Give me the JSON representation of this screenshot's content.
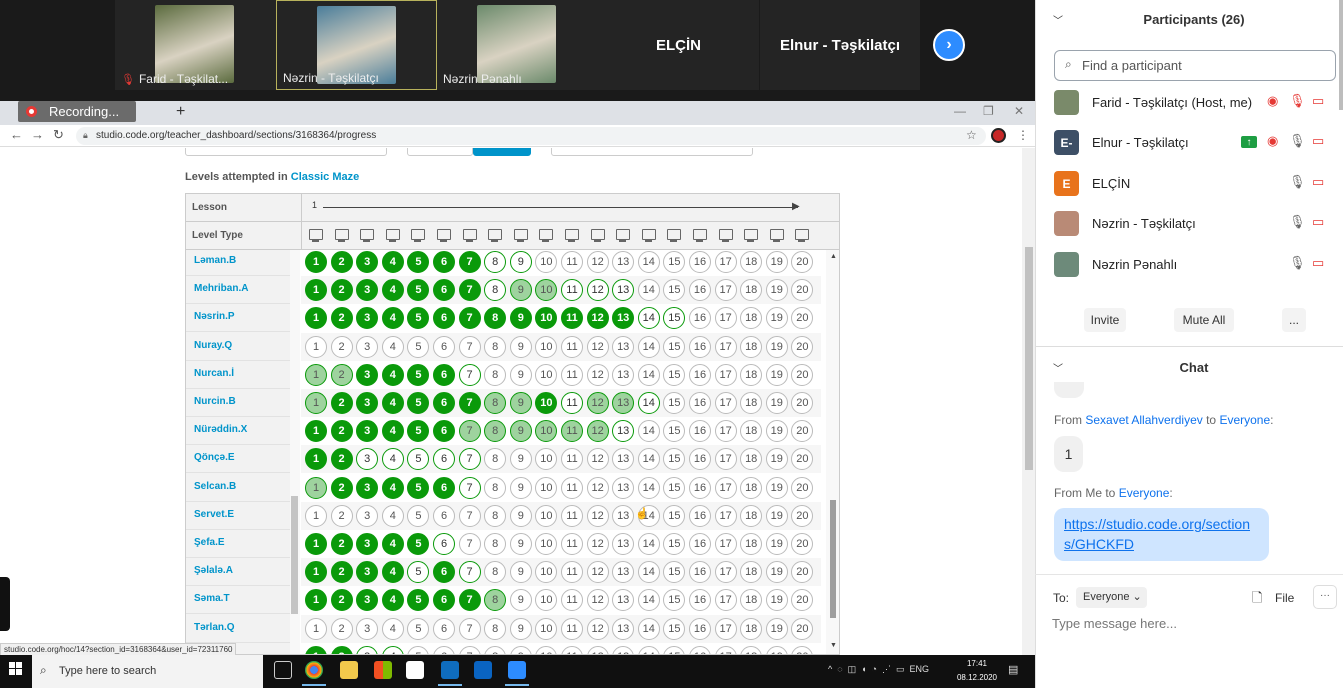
{
  "video_strip": {
    "tiles": [
      {
        "name": "Farid - Təşkilat...",
        "muted": true
      },
      {
        "name": "Nəzrin - Təşkilatçı",
        "muted": false
      },
      {
        "name": "Nəzrin Pənahlı",
        "muted": false
      },
      {
        "name": "ELÇİN",
        "muted": false
      },
      {
        "name": "Elnur - Təşkilatçı",
        "muted": false
      }
    ],
    "next_arrow": "›"
  },
  "recording": {
    "label": "Recording..."
  },
  "browser": {
    "url": "studio.code.org/teacher_dashboard/sections/3168364/progress",
    "status_url": "studio.code.org/hoc/14?section_id=3168364&user_id=72311760"
  },
  "page": {
    "heading_prefix": "Levels attempted in",
    "heading_link": "Classic Maze",
    "lesson_label": "Lesson",
    "lesson_number": "1",
    "level_type_label": "Level Type",
    "students": [
      "Ləman.B",
      "Mehriban.A",
      "Nəsrin.P",
      "Nuray.Q",
      "Nurcan.İ",
      "Nurcin.B",
      "Nürəddin.X",
      "Qönçə.E",
      "Selcan.B",
      "Servet.E",
      "Şefa.E",
      "Şəlalə.A",
      "Səma.T",
      "Tərlan.Q"
    ],
    "level_count": 20,
    "progress_rows": [
      "11111113300000000000",
      "11111113223330000000",
      "11111111111113300000",
      "00000000000000000000",
      "22111130000000000000",
      "21111112213223000000",
      "11111122222230000000",
      "11333330000000000000",
      "21111130000000000000",
      "00000000000000000000",
      "11111300000000000000",
      "11113130000000000000",
      "11111112000000000000",
      "00000000000000000000",
      "11330000000000000000"
    ]
  },
  "taskbar": {
    "search_placeholder": "Type here to search",
    "tray_text": "ENG",
    "time": "17:41",
    "date": "08.12.2020"
  },
  "participants": {
    "title": "Participants (26)",
    "search_placeholder": "Find a participant",
    "list": [
      {
        "name": "Farid - Təşkilatçı (Host, me)",
        "avatar_text": "",
        "avatar_color": "#7a8a6a"
      },
      {
        "name": "Elnur - Təşkilatçı",
        "avatar_text": "E-",
        "avatar_color": "#3d4f66"
      },
      {
        "name": "ELÇİN",
        "avatar_text": "E",
        "avatar_color": "#e8731c"
      },
      {
        "name": "Nəzrin - Təşkilatçı",
        "avatar_text": "",
        "avatar_color": "#b98a76"
      },
      {
        "name": "Nəzrin Pənahlı",
        "avatar_text": "",
        "avatar_color": "#6d8a7a"
      }
    ],
    "invite_label": "Invite",
    "mute_all_label": "Mute All",
    "more_label": "..."
  },
  "chat": {
    "title": "Chat",
    "msg1_from_prefix": "From",
    "msg1_sender": "Sexavet Allahverdiyev",
    "msg1_to_word": "to",
    "msg1_recipient": "Everyone",
    "msg1_suffix": ":",
    "msg1_text": "1",
    "msg2_prefix": "From Me to",
    "msg2_recipient": "Everyone",
    "msg2_suffix": ":",
    "msg2_text": "https://studio.code.org/sections/GHCKFD",
    "to_label": "To:",
    "to_value": "Everyone",
    "file_label": "File",
    "more_label": "···",
    "input_placeholder": "Type message here..."
  }
}
